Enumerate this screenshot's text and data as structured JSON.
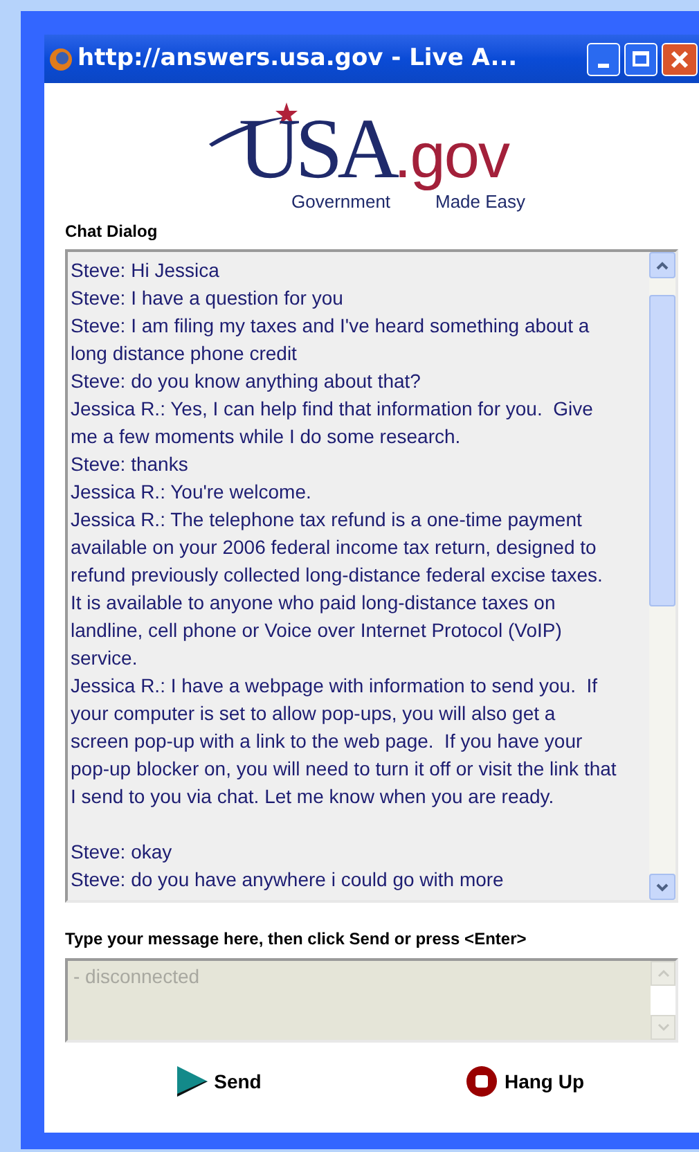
{
  "window": {
    "title": "http://answers.usa.gov - Live A..."
  },
  "logo": {
    "main": "USA",
    "suffix": ".gov",
    "tagline_left": "Government",
    "tagline_right": "Made Easy"
  },
  "chat": {
    "label": "Chat Dialog",
    "messages": [
      {
        "text": "Steve: Hi Jessica",
        "blank_after": false
      },
      {
        "text": "Steve: I have a question for you",
        "blank_after": false
      },
      {
        "text": "Steve: I am filing my taxes and I've heard something about a long distance phone credit",
        "blank_after": false
      },
      {
        "text": "Steve: do you know anything about that?",
        "blank_after": false
      },
      {
        "text": "Jessica R.: Yes, I can help find that information for you.  Give me a few moments while I do some research.",
        "blank_after": false
      },
      {
        "text": "Steve: thanks",
        "blank_after": false
      },
      {
        "text": "Jessica R.: You're welcome.",
        "blank_after": false
      },
      {
        "text": "Jessica R.: The telephone tax refund is a one-time payment available on your 2006 federal income tax return, designed to refund previously collected long-distance federal excise taxes. It is available to anyone who paid long-distance taxes on landline, cell phone or Voice over Internet Protocol (VoIP) service.",
        "blank_after": false
      },
      {
        "text": "Jessica R.: I have a webpage with information to send you.  If your computer is set to allow pop-ups, you will also get a screen pop-up with a link to the web page.  If you have your pop-up blocker on, you will need to turn it off or visit the link that I send to you via chat. Let me know when you are ready.",
        "blank_after": true
      },
      {
        "text": "Steve: okay",
        "blank_after": false
      },
      {
        "text": "Steve: do you have anywhere i could go with more",
        "blank_after": false
      }
    ]
  },
  "message_input": {
    "label": "Type your message here, then click Send or press <Enter>",
    "placeholder": "- disconnected",
    "disabled": true
  },
  "buttons": [
    {
      "kind": "send",
      "label": "Send"
    },
    {
      "kind": "hangup",
      "label": "Hang Up"
    }
  ]
}
